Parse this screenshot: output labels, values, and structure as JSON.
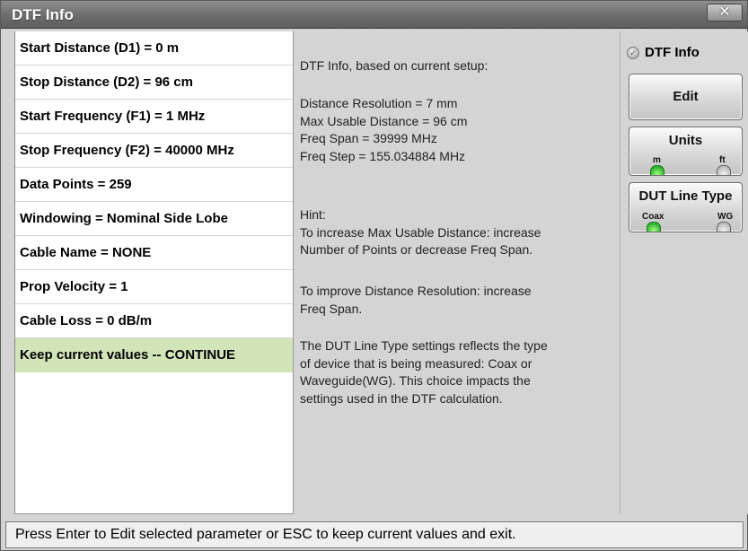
{
  "window": {
    "title": "DTF Info",
    "close_glyph": "✕"
  },
  "params": [
    {
      "label": "Start Distance (D1) = 0 m",
      "selected": false
    },
    {
      "label": "Stop Distance (D2) = 96 cm",
      "selected": false
    },
    {
      "label": "Start Frequency (F1) = 1 MHz",
      "selected": false
    },
    {
      "label": "Stop Frequency (F2) = 40000 MHz",
      "selected": false
    },
    {
      "label": "Data Points = 259",
      "selected": false
    },
    {
      "label": "Windowing = Nominal Side Lobe",
      "selected": false
    },
    {
      "label": "Cable Name = NONE",
      "selected": false
    },
    {
      "label": "Prop Velocity = 1",
      "selected": false
    },
    {
      "label": "Cable Loss = 0 dB/m",
      "selected": false
    },
    {
      "label": "Keep current values -- CONTINUE",
      "selected": true
    }
  ],
  "info": {
    "heading": "DTF Info, based on current setup:",
    "calc_lines": "Distance Resolution = 7 mm\nMax Usable Distance = 96 cm\nFreq Span = 39999 MHz\nFreq Step = 155.034884 MHz",
    "hint": "Hint:\nTo increase Max Usable Distance: increase\nNumber of Points or decrease Freq Span.",
    "improve": "To improve Distance Resolution: increase\nFreq Span.",
    "dut_note": "The DUT Line Type settings reflects the type\nof device that is being measured: Coax or\nWaveguide(WG). This choice impacts the\nsettings used in the DTF calculation."
  },
  "softkeys": {
    "menu_title": "DTF Info",
    "edit_label": "Edit",
    "units": {
      "label": "Units",
      "opt_left": "m",
      "opt_right": "ft",
      "selected": "m"
    },
    "dut": {
      "label": "DUT Line Type",
      "opt_left": "Coax",
      "opt_right": "WG",
      "selected": "Coax"
    }
  },
  "status": "Press Enter to Edit selected parameter or ESC to keep current values and exit.",
  "colors": {
    "selected_row": "#d2e5b9",
    "titlebar": "#6d6d6d",
    "led_on": "#2db32d"
  }
}
